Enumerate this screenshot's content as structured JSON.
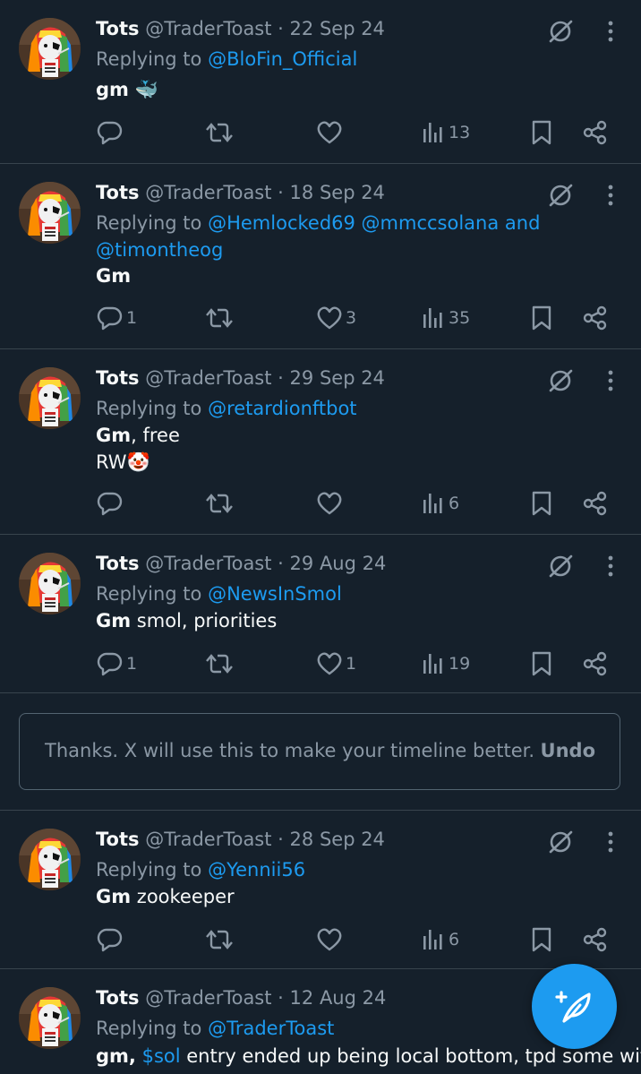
{
  "tweets": [
    {
      "name": "Tots",
      "handle": "@TraderToast",
      "sep": "·",
      "date": "22 Sep 24",
      "replying_prefix": "Replying to",
      "mentions_line1": "@BloFin_Official",
      "mentions_line2": "",
      "bold": "gm",
      "text": "",
      "text2": "",
      "emoji": "🐳",
      "replies": "",
      "reposts": "",
      "likes": "",
      "views": "13"
    },
    {
      "name": "Tots",
      "handle": "@TraderToast",
      "sep": "·",
      "date": "18 Sep 24",
      "replying_prefix": "Replying to",
      "mentions_line1": "@Hemlocked69 @mmccsolana and",
      "mentions_line2": "@timontheog",
      "bold": "Gm",
      "text": "",
      "text2": "",
      "emoji": "",
      "replies": "1",
      "reposts": "",
      "likes": "3",
      "views": "35"
    },
    {
      "name": "Tots",
      "handle": "@TraderToast",
      "sep": "·",
      "date": "29 Sep 24",
      "replying_prefix": "Replying to",
      "mentions_line1": "@retardionftbot",
      "mentions_line2": "",
      "bold": "Gm",
      "text": ", free",
      "text2": "RW",
      "emoji": "🤡",
      "replies": "",
      "reposts": "",
      "likes": "",
      "views": "6"
    },
    {
      "name": "Tots",
      "handle": "@TraderToast",
      "sep": "·",
      "date": "29 Aug 24",
      "replying_prefix": "Replying to",
      "mentions_line1": "@NewsInSmol",
      "mentions_line2": "",
      "bold": "Gm",
      "text": " smol, priorities",
      "text2": "",
      "emoji": "",
      "replies": "1",
      "reposts": "",
      "likes": "1",
      "views": "19"
    },
    {
      "name": "Tots",
      "handle": "@TraderToast",
      "sep": "·",
      "date": "28 Sep 24",
      "replying_prefix": "Replying to",
      "mentions_line1": "@Yennii56",
      "mentions_line2": "",
      "bold": "Gm",
      "text": " zookeeper",
      "text2": "",
      "emoji": "",
      "replies": "",
      "reposts": "",
      "likes": "",
      "views": "6"
    },
    {
      "name": "Tots",
      "handle": "@TraderToast",
      "sep": "·",
      "date": "12 Aug 24",
      "replying_prefix": "Replying to",
      "mentions_line1": "@TraderToast",
      "mentions_line2": "",
      "bold": "gm,",
      "cashtag": "$sol",
      "text": " entry ended up being local bottom, tpd some with",
      "text2": "",
      "emoji": ""
    }
  ],
  "notice": {
    "text": "Thanks. X will use this to make your timeline better.",
    "undo": "Undo"
  },
  "icons": {
    "grok": "grok-icon",
    "more": "more-icon",
    "reply": "reply-icon",
    "repost": "repost-icon",
    "like": "heart-icon",
    "views": "views-icon",
    "bookmark": "bookmark-icon",
    "share": "share-icon",
    "compose": "compose-icon"
  },
  "colors": {
    "background": "#15202b",
    "accent": "#1d9bf0",
    "muted": "#8b98a5",
    "text": "#f7f9f9"
  }
}
